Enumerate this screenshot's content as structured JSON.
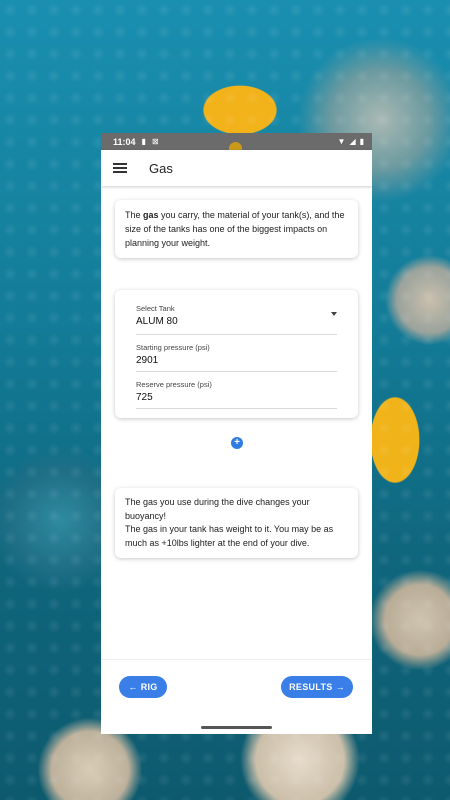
{
  "status_bar": {
    "time": "11:04",
    "icons": [
      "sim-card-icon",
      "a-box-icon"
    ],
    "right_icons": [
      "wifi-icon",
      "signal-icon",
      "battery-icon"
    ]
  },
  "app_bar": {
    "title": "Gas",
    "menu_icon": "hamburger-menu-icon"
  },
  "intro": {
    "text_before": "The ",
    "bold": "gas",
    "text_after": " you carry, the material of your tank(s), and the size of the tanks has one of the biggest impacts on planning your weight."
  },
  "form": {
    "tank": {
      "label": "Select Tank",
      "value": "ALUM 80"
    },
    "start_pressure": {
      "label": "Starting pressure (psi)",
      "value": "2901"
    },
    "reserve_pressure": {
      "label": "Reserve pressure (psi)",
      "value": "725"
    }
  },
  "add_tank": {
    "icon": "plus-circle-icon",
    "glyph": "+"
  },
  "info": {
    "line1": "The gas you use during the dive changes your buoyancy!",
    "line2": "The gas in your tank has weight to it. You may be as much as +10lbs lighter at the end of your dive."
  },
  "navigation": {
    "back_label": "RIG",
    "back_arrow": "←",
    "next_label": "RESULTS",
    "next_arrow": "→"
  },
  "colors": {
    "accent": "#3a7ee8",
    "status_bar": "#6b6b6b"
  }
}
